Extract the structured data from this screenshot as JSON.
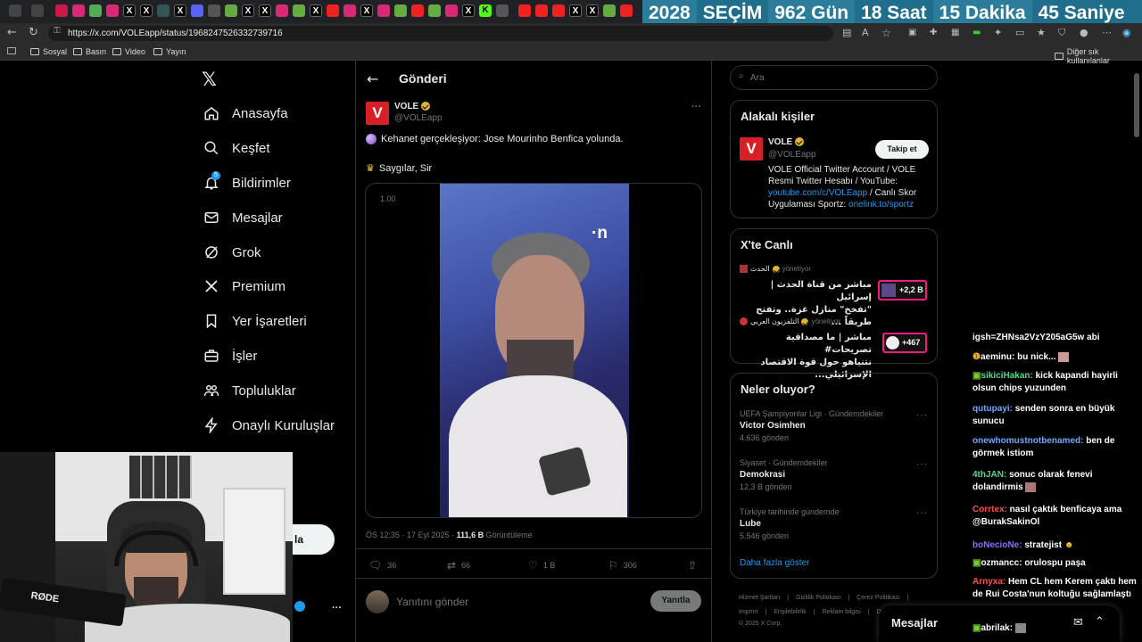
{
  "browser": {
    "url": "https://x.com/VOLEapp/status/1968247526332739716",
    "bookmarks": [
      "Sosyal",
      "Basın",
      "Video",
      "Yayın"
    ],
    "other_bookmarks": "Diğer sık kullanılanlar"
  },
  "election_banner": [
    "2028",
    "SEÇİM",
    "962 Gün",
    "18 Saat",
    "15 Dakika",
    "45 Saniye"
  ],
  "nav": {
    "items": [
      "Anasayfa",
      "Keşfet",
      "Bildirimler",
      "Mesajlar",
      "Grok",
      "Premium",
      "Yer İşaretleri",
      "İşler",
      "Topluluklar",
      "Onaylı Kuruluşlar"
    ],
    "notification_badge": "5",
    "partial_button": "la"
  },
  "post": {
    "header": "Gönderi",
    "author_name": "VOLE",
    "author_handle": "@VOLEapp",
    "text_line1": "Kehanet gerçekleşiyor: Jose Mourinho Benfica yolunda.",
    "text_line2": "Saygılar, Sir",
    "video_label": "1.00",
    "meta_time": "ÖS 12:35 · 17 Eyl 2025 · ",
    "meta_views": "111,6 B",
    "meta_views_label": "Görüntüleme",
    "stats": {
      "replies": "36",
      "reposts": "66",
      "likes": "1 B",
      "bookmarks": "306"
    },
    "reply_placeholder": "Yanıtını gönder",
    "reply_button": "Yanıtla"
  },
  "search": {
    "placeholder": "Ara"
  },
  "related": {
    "title": "Alakalı kişiler",
    "name": "VOLE",
    "handle": "@VOLEapp",
    "follow": "Takip et",
    "bio1": "VOLE Official Twitter Account / VOLE",
    "bio2": "Resmi Twitter Hesabı / YouTube:",
    "bio_link": "youtube.com/c/VOLEapp",
    "bio3": " / Canlı Skor",
    "bio4": "Uygulaması Sportz: ",
    "bio_link2": "onelink.to/sportz"
  },
  "live": {
    "title": "X'te Canlı",
    "items": [
      {
        "host": "الحدث",
        "hosting": "yönetiyor",
        "line1": "مباشر من قناة الحدث | إسرائيل",
        "line2": "\"تفخخ\" منازل غزة.. وتفتح طريقاً ...",
        "count": "+2,2 B"
      },
      {
        "host": "التلفزيون العربي",
        "hosting": "yönetiyor",
        "line1": "مباشر | ما مصداقية تصريحات#",
        "line2": "نتنياهو حول قوة الاقتصاد الإسرائيلي...",
        "count": "+467"
      }
    ]
  },
  "trends": {
    "title": "Neler oluyor?",
    "items": [
      {
        "context": "UEFA Şampiyonlar Ligi · Gündemdekiler",
        "name": "Victor Osimhen",
        "count": "4.636 gönderi"
      },
      {
        "context": "Siyaset · Gündemdekiler",
        "name": "Demokrasi",
        "count": "12,3 B gönderi"
      },
      {
        "context": "Türkiye tarihinde gündemde",
        "name": "Lube",
        "count": "5.546 gönderi"
      }
    ],
    "more": "Daha fazla göster"
  },
  "footer": {
    "line1": [
      "Hizmet Şartları",
      "|",
      "Gizlilik Politikası",
      "|",
      "Çerez Politikası",
      "|"
    ],
    "line2": [
      "Imprint",
      "|",
      "Erişilebilirlik",
      "|",
      "Reklam bilgisi",
      "|",
      "D"
    ],
    "copyright": "© 2025 X Corp."
  },
  "messages_bar": "Mesajlar",
  "chat": [
    {
      "user": "",
      "text": "igsh=ZHNsa2VzY205aG5w abi",
      "color": "#ffffff"
    },
    {
      "user": "aeminu:",
      "text": " bu nick...",
      "color": "#ffffff"
    },
    {
      "user": "sikiciHakan:",
      "text": " kick kapandi hayirli olsun chips yuzunden",
      "color": "#58d68d"
    },
    {
      "user": "qutupayi:",
      "text": " senden sonra en büyük sunucu",
      "color": "#6fa8ff"
    },
    {
      "user": "onewhomustnotbenamed:",
      "text": " ben de görmek istiom",
      "color": "#6fa8ff"
    },
    {
      "user": "4thJAN:",
      "text": " sonuc olarak fenevi dolandirmis",
      "color": "#58d68d"
    },
    {
      "user": "Corrtex:",
      "text": " nasıl çaktık benficaya ama @BurakSakinOl",
      "color": "#ff4d4d"
    },
    {
      "user": "boNecioNe:",
      "text": " stratejist",
      "color": "#8c6cff"
    },
    {
      "user": "ozmancc:",
      "text": " orulospu paşa",
      "color": "#ffffff"
    },
    {
      "user": "Arnyxa:",
      "text": " Hem CL hem Kerem çaktı hem de Rui Costa'nun koltuğu sağlamlaştı",
      "color": "#ff4d4d"
    },
    {
      "user": "abrilak:",
      "text": "",
      "color": "#ffffff"
    }
  ],
  "webcam_text": "RØDE",
  "colors": {
    "accent": "#1d9bf0",
    "vole_red": "#d61f26",
    "banner": "#1f6e8c"
  }
}
